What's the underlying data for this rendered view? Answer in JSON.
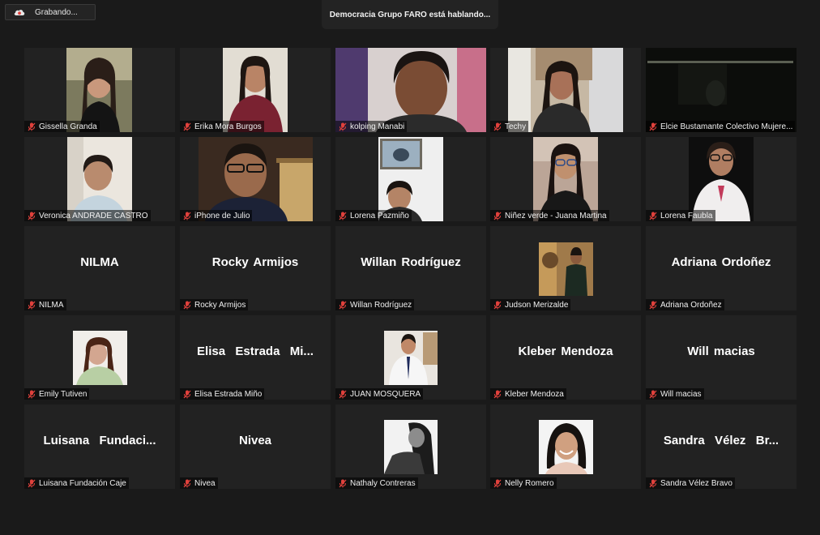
{
  "recording": {
    "label": "Grabando...",
    "icon": "cloud-record-icon"
  },
  "speaker_banner": {
    "text": "Democracia Grupo FARO está hablando..."
  },
  "tile_icon": "muted-mic-icon",
  "tiles": [
    {
      "label": "Gissella Granda",
      "has_video": true
    },
    {
      "label": "Erika Mora Burgos",
      "has_video": true
    },
    {
      "label": "kolping Manabi",
      "has_video": true
    },
    {
      "label": "Techy",
      "has_video": true
    },
    {
      "label": "Elcie Bustamante Colectivo Mujere...",
      "has_video": true
    },
    {
      "label": "Veronica ANDRADE CASTRO",
      "has_video": true
    },
    {
      "label": "iPhone de Julio",
      "has_video": true
    },
    {
      "label": "Lorena Pazmiño",
      "has_video": true
    },
    {
      "label": "Niñez verde - Juana Martina",
      "has_video": true
    },
    {
      "label": "Lorena Faubla",
      "has_video": true
    },
    {
      "label": "NILMA",
      "display_name": "NILMA",
      "has_video": false
    },
    {
      "label": "Rocky Armijos",
      "display_name": "Rocky Armijos",
      "has_video": false
    },
    {
      "label": "Willan Rodríguez",
      "display_name": "Willan Rodríguez",
      "has_video": false
    },
    {
      "label": "Judson Merizalde",
      "has_video": true
    },
    {
      "label": "Adriana Ordoñez",
      "display_name": "Adriana Ordoñez",
      "has_video": false
    },
    {
      "label": "Emily Tutiven",
      "has_video": true
    },
    {
      "label": "Elisa Estrada Miño",
      "display_name": "Elisa  Estrada  Mi...",
      "has_video": false
    },
    {
      "label": "JUAN MOSQUERA",
      "has_video": true
    },
    {
      "label": "Kleber Mendoza",
      "display_name": "Kleber Mendoza",
      "has_video": false
    },
    {
      "label": "Will macias",
      "display_name": "Will macias",
      "has_video": false
    },
    {
      "label": "Luisana Fundación Caje",
      "display_name": "Luisana  Fundaci...",
      "has_video": false
    },
    {
      "label": "Nivea",
      "display_name": "Nivea",
      "has_video": false
    },
    {
      "label": "Nathaly Contreras",
      "has_video": true
    },
    {
      "label": "Nelly Romero",
      "has_video": true
    },
    {
      "label": "Sandra Vélez Bravo",
      "display_name": "Sandra  Vélez  Br...",
      "has_video": false
    }
  ]
}
